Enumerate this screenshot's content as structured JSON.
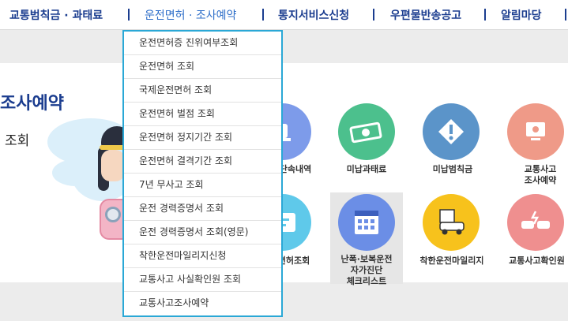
{
  "nav": {
    "items": [
      {
        "label": "교통범칙금 · 과태료"
      },
      {
        "label": "운전면허 · 조사예약"
      },
      {
        "label": "통지서비스신청"
      },
      {
        "label": "우편물반송공고"
      },
      {
        "label": "알림마당"
      }
    ],
    "active_index": 1
  },
  "page": {
    "title": "조사예약",
    "subtitle": "조회"
  },
  "dropdown": {
    "items": [
      {
        "label": "운전면허증 진위여부조회"
      },
      {
        "label": "운전면허 조회"
      },
      {
        "label": "국제운전면허 조회"
      },
      {
        "label": "운전면허 벌점 조회"
      },
      {
        "label": "운전면허 정지기간 조회"
      },
      {
        "label": "운전면허 결격기간 조회"
      },
      {
        "label": "7년 무사고 조회"
      },
      {
        "label": "운전 경력증명서 조회"
      },
      {
        "label": "운전 경력증명서 조회(영문)"
      },
      {
        "label": "착한운전마일리지신청"
      },
      {
        "label": "교통사고 사실확인원 조회"
      },
      {
        "label": "교통사고조사예약"
      }
    ]
  },
  "tiles": {
    "row1": [
      {
        "label": "단속내역",
        "icon": "police-light-icon",
        "color": "#7d9bea"
      },
      {
        "label": "미납과태료",
        "icon": "money-bill-icon",
        "color": "#4cc08d"
      },
      {
        "label": "미납범칙금",
        "icon": "warning-diamond-icon",
        "color": "#5b94c9"
      },
      {
        "label": "교통사고\n조사예약",
        "icon": "computer-monitor-icon",
        "color": "#ef9a88"
      }
    ],
    "row2": [
      {
        "label": "면허조회",
        "icon": "license-card-icon",
        "color": "#5fc9ea"
      },
      {
        "label": "난폭·보복운전\n자가진단\n체크리스트",
        "icon": "calendar-checklist-icon",
        "color": "#6b8ee6"
      },
      {
        "label": "착한운전마일리지",
        "icon": "mileage-car-icon",
        "color": "#f7c21c"
      },
      {
        "label": "교통사고확인원",
        "icon": "car-crash-icon",
        "color": "#ef8f8f"
      }
    ]
  }
}
